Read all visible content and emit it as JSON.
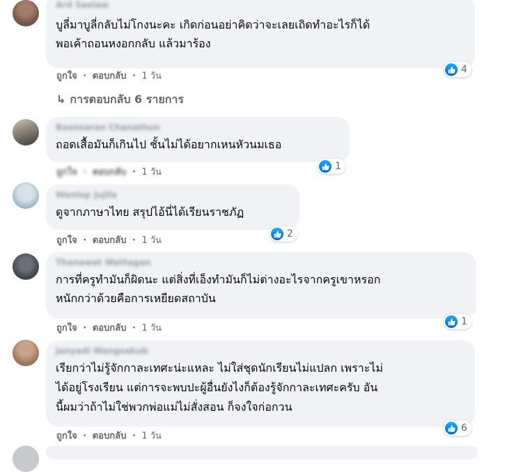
{
  "actions": {
    "like": "ถูกใจ",
    "reply": "ตอบกลับ",
    "separator": "·"
  },
  "colors": {
    "bubble": "#f0f2f5",
    "meta": "#65676b",
    "like_blue": "#1877f2"
  },
  "comments": [
    {
      "author": "Ard Saelaw",
      "lines": [
        "บูลี่มาบูลี่กลับไม่โกงนะคะ เกิดก่อนอย่าคิดว่าจะเลยเถิดทำอะไรก็ได้",
        "พอเค้าถอนหงอกกลับ แล้วมาร้อง"
      ],
      "time": "1 วัน",
      "reactions": "4",
      "reaction_icon": "like-icon"
    },
    {
      "author": "Boonsaran Chanathun",
      "lines": [
        "ถอดเสื้อมันก็เกินไป ชั้นไม่ได้อยากเหนหัวนมเธอ"
      ],
      "time": "1 วัน",
      "reactions": "1",
      "reaction_icon": "like-icon"
    },
    {
      "author": "Wanlop Jujila",
      "lines": [
        "ดูจากภาษาไทย สรุปไอ้นี่ได้เรียนราชภัฏ"
      ],
      "time": "1 วัน",
      "reactions": "2",
      "reaction_icon": "like-icon"
    },
    {
      "author": "Thanawat Wattagan",
      "lines": [
        "การที่ครูทำมันก็ผิดนะ แต่สิ่งที่เอ็งทำมันก็ไม่ต่างอะไรจากครูเขาหรอก",
        "หนักกว่าด้วยคือการเหยียดสถาบัน"
      ],
      "time": "1 วัน",
      "reactions": "1",
      "reaction_icon": "like-icon"
    },
    {
      "author": "Janyadi Wangsakub",
      "lines": [
        "เรียกว่าไม่รู้จักกาละเทศะน่ะแหละ ไม่ใส่ชุดนักเรียนไม่แปลก เพราะไม่",
        "ได้อยู่โรงเรียน แต่การจะพบปะผู้อื่นยังไงก็ต้องรู้จักกาละเทศะครับ อัน",
        "นี้ผมว่าถ้าไม่ใช่พวกพ่อแม่ไม่สั่งสอน ก็จงใจก่อกวน"
      ],
      "time": "1 วัน",
      "reactions": "6",
      "reaction_icon": "like-icon"
    }
  ],
  "replies_link": {
    "arrow": "↳",
    "label": "การตอบกลับ 6 รายการ"
  }
}
